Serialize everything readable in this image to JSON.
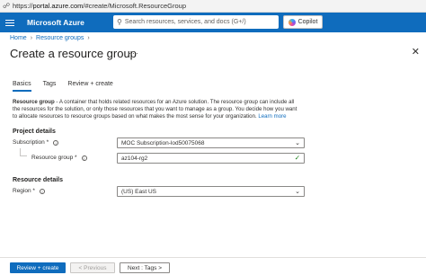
{
  "browser": {
    "url_prefix": "https://",
    "url_host": "portal.azure.com",
    "url_path": "/#create/Microsoft.ResourceGroup"
  },
  "topbar": {
    "brand": "Microsoft Azure",
    "search_placeholder": "Search resources, services, and docs (G+/)",
    "copilot_label": "Copilot"
  },
  "breadcrumb": {
    "items": [
      "Home",
      "Resource groups"
    ]
  },
  "page": {
    "title": "Create a resource group",
    "more": "···"
  },
  "tabs": [
    {
      "label": "Basics",
      "active": true
    },
    {
      "label": "Tags",
      "active": false
    },
    {
      "label": "Review + create",
      "active": false
    }
  ],
  "description": {
    "lead": "Resource group",
    "body": " - A container that holds related resources for an Azure solution. The resource group can include all the resources for the solution, or only those resources that you want to manage as a group. You decide how you want to allocate resources to resource groups based on what makes the most sense for your organization. ",
    "learn_more": "Learn more"
  },
  "project_details": {
    "title": "Project details",
    "subscription_label": "Subscription *",
    "subscription_value": "MOC Subscription-lod50075068",
    "resource_group_label": "Resource group *",
    "resource_group_value": "az104-rg2"
  },
  "resource_details": {
    "title": "Resource details",
    "region_label": "Region *",
    "region_value": "(US) East US"
  },
  "footer": {
    "review_create": "Review + create",
    "previous": "< Previous",
    "next": "Next : Tags >"
  },
  "colors": {
    "accent": "#0f6cbd",
    "valid": "#107c10"
  }
}
